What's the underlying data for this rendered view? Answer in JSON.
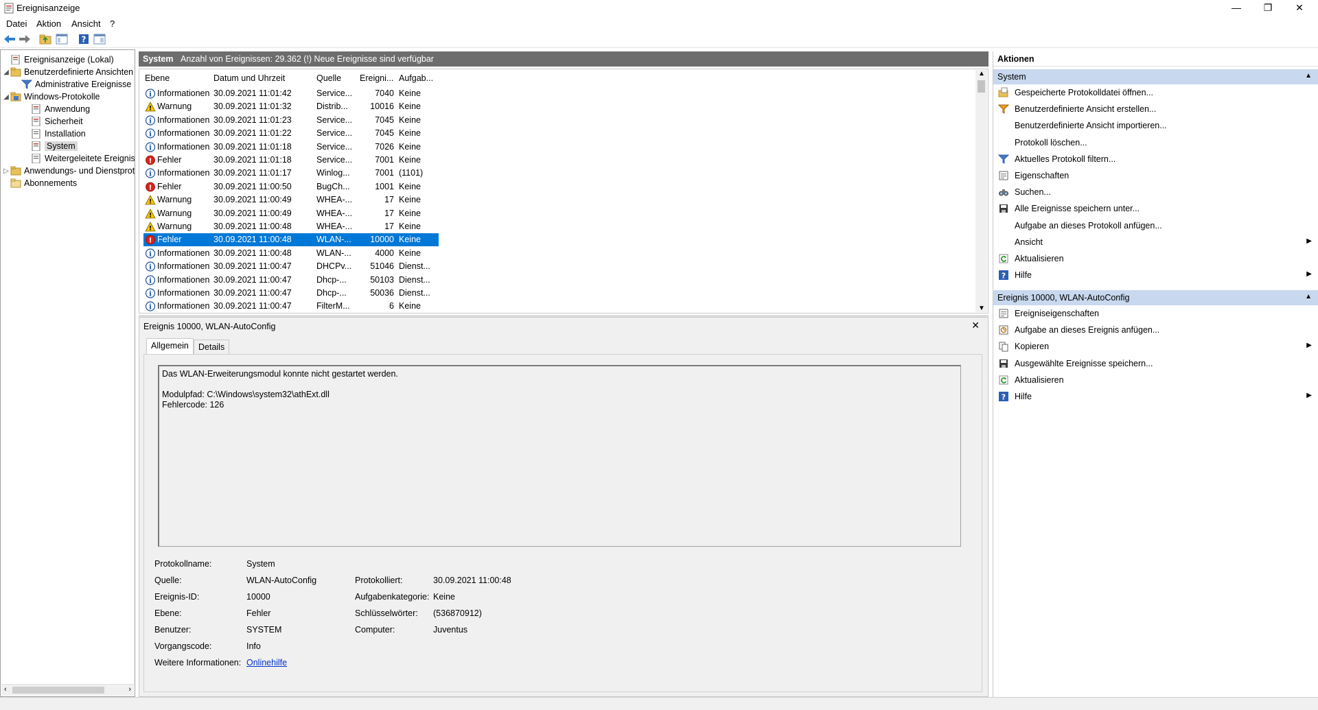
{
  "window": {
    "title": "Ereignisanzeige",
    "minimize": "—",
    "restore": "❐",
    "close": "✕"
  },
  "menu": [
    "Datei",
    "Aktion",
    "Ansicht",
    "?"
  ],
  "tree": {
    "root": "Ereignisanzeige (Lokal)",
    "custom_views": "Benutzerdefinierte Ansichten",
    "admin_events": "Administrative Ereignisse",
    "windows_logs": "Windows-Protokolle",
    "application": "Anwendung",
    "security": "Sicherheit",
    "setup": "Installation",
    "system": "System",
    "forwarded": "Weitergeleitete Ereignisse",
    "app_services": "Anwendungs- und Dienstprotokolle",
    "subscriptions": "Abonnements"
  },
  "center": {
    "header_title": "System",
    "header_info": "Anzahl von Ereignissen: 29.362 (!) Neue Ereignisse sind verfügbar",
    "columns": [
      "Ebene",
      "Datum und Uhrzeit",
      "Quelle",
      "Ereigni...",
      "Aufgab..."
    ],
    "rows": [
      {
        "level": "Informationen",
        "type": "info",
        "date": "30.09.2021 11:01:42",
        "source": "Service...",
        "id": "7040",
        "task": "Keine"
      },
      {
        "level": "Warnung",
        "type": "warn",
        "date": "30.09.2021 11:01:32",
        "source": "Distrib...",
        "id": "10016",
        "task": "Keine"
      },
      {
        "level": "Informationen",
        "type": "info",
        "date": "30.09.2021 11:01:23",
        "source": "Service...",
        "id": "7045",
        "task": "Keine"
      },
      {
        "level": "Informationen",
        "type": "info",
        "date": "30.09.2021 11:01:22",
        "source": "Service...",
        "id": "7045",
        "task": "Keine"
      },
      {
        "level": "Informationen",
        "type": "info",
        "date": "30.09.2021 11:01:18",
        "source": "Service...",
        "id": "7026",
        "task": "Keine"
      },
      {
        "level": "Fehler",
        "type": "error",
        "date": "30.09.2021 11:01:18",
        "source": "Service...",
        "id": "7001",
        "task": "Keine"
      },
      {
        "level": "Informationen",
        "type": "info",
        "date": "30.09.2021 11:01:17",
        "source": "Winlog...",
        "id": "7001",
        "task": "(1101)"
      },
      {
        "level": "Fehler",
        "type": "error",
        "date": "30.09.2021 11:00:50",
        "source": "BugCh...",
        "id": "1001",
        "task": "Keine"
      },
      {
        "level": "Warnung",
        "type": "warn",
        "date": "30.09.2021 11:00:49",
        "source": "WHEA-...",
        "id": "17",
        "task": "Keine"
      },
      {
        "level": "Warnung",
        "type": "warn",
        "date": "30.09.2021 11:00:49",
        "source": "WHEA-...",
        "id": "17",
        "task": "Keine"
      },
      {
        "level": "Warnung",
        "type": "warn",
        "date": "30.09.2021 11:00:48",
        "source": "WHEA-...",
        "id": "17",
        "task": "Keine"
      },
      {
        "level": "Fehler",
        "type": "error",
        "date": "30.09.2021 11:00:48",
        "source": "WLAN-...",
        "id": "10000",
        "task": "Keine",
        "selected": true
      },
      {
        "level": "Informationen",
        "type": "info",
        "date": "30.09.2021 11:00:48",
        "source": "WLAN-...",
        "id": "4000",
        "task": "Keine"
      },
      {
        "level": "Informationen",
        "type": "info",
        "date": "30.09.2021 11:00:47",
        "source": "DHCPv...",
        "id": "51046",
        "task": "Dienst..."
      },
      {
        "level": "Informationen",
        "type": "info",
        "date": "30.09.2021 11:00:47",
        "source": "Dhcp-...",
        "id": "50103",
        "task": "Dienst..."
      },
      {
        "level": "Informationen",
        "type": "info",
        "date": "30.09.2021 11:00:47",
        "source": "Dhcp-...",
        "id": "50036",
        "task": "Dienst..."
      },
      {
        "level": "Informationen",
        "type": "info",
        "date": "30.09.2021 11:00:47",
        "source": "FilterM...",
        "id": "6",
        "task": "Keine"
      }
    ]
  },
  "detail": {
    "title": "Ereignis 10000, WLAN-AutoConfig",
    "tabs": [
      "Allgemein",
      "Details"
    ],
    "description": [
      "Das WLAN-Erweiterungsmodul konnte nicht gestartet werden.",
      "",
      "Modulpfad: C:\\Windows\\system32\\athExt.dll",
      "Fehlercode: 126"
    ],
    "labels": {
      "log_name": "Protokollname:",
      "source": "Quelle:",
      "event_id": "Ereignis-ID:",
      "level": "Ebene:",
      "user": "Benutzer:",
      "opcode": "Vorgangscode:",
      "more_info": "Weitere Informationen:",
      "logged": "Protokolliert:",
      "task_category": "Aufgabenkategorie:",
      "keywords": "Schlüsselwörter:",
      "computer": "Computer:"
    },
    "values": {
      "log_name": "System",
      "source": "WLAN-AutoConfig",
      "event_id": "10000",
      "level": "Fehler",
      "user": "SYSTEM",
      "opcode": "Info",
      "more_info": "Onlinehilfe",
      "logged": "30.09.2021 11:00:48",
      "task_category": "Keine",
      "keywords": "(536870912)",
      "computer": "Juventus"
    }
  },
  "actions": {
    "title": "Aktionen",
    "group1": "System",
    "group1_items": [
      "Gespeicherte Protokolldatei öffnen...",
      "Benutzerdefinierte Ansicht erstellen...",
      "Benutzerdefinierte Ansicht importieren...",
      "Protokoll löschen...",
      "Aktuelles Protokoll filtern...",
      "Eigenschaften",
      "Suchen...",
      "Alle Ereignisse speichern unter...",
      "Aufgabe an dieses Protokoll anfügen...",
      "Ansicht",
      "Aktualisieren",
      "Hilfe"
    ],
    "group2": "Ereignis 10000, WLAN-AutoConfig",
    "group2_items": [
      "Ereigniseigenschaften",
      "Aufgabe an dieses Ereignis anfügen...",
      "Kopieren",
      "Ausgewählte Ereignisse speichern...",
      "Aktualisieren",
      "Hilfe"
    ]
  },
  "colors": {
    "selection": "#0078d7",
    "header_bar": "#6d6d6d",
    "group_header": "#c8d8ee",
    "link": "#0033cc"
  }
}
